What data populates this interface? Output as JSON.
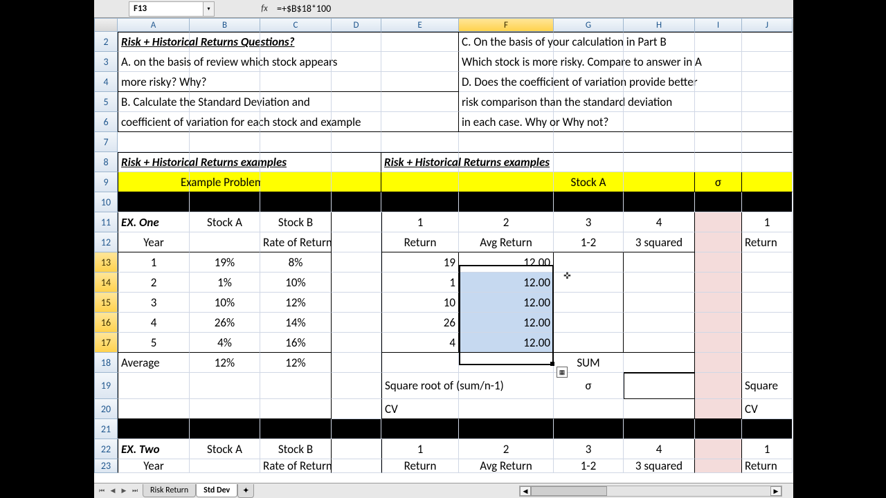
{
  "namebox": "F13",
  "formula": "=+$B$18*100",
  "fx_label": "fx",
  "columns": [
    "A",
    "B",
    "C",
    "D",
    "E",
    "F",
    "G",
    "H",
    "I",
    "J"
  ],
  "active_col": "F",
  "rows": {
    "2": {
      "A": "Risk + Historical Returns Questions?",
      "F": "C. On the basis of your calculation in Part B"
    },
    "3": {
      "A": "A. on the basis of review which stock appears",
      "F": "Which stock is more risky. Compare to answer in A"
    },
    "4": {
      "A": "more risky?  Why?",
      "F": "D. Does the coefficient of variation provide better"
    },
    "5": {
      "A": "B. Calculate the Standard Deviation and",
      "F": "risk comparison than the standard deviation"
    },
    "6": {
      "A": "coefficient of variation for each stock and example",
      "F": "in each case. Why or Why not?"
    },
    "8": {
      "A": "Risk + Historical Returns examples",
      "E": "Risk + Historical Returns examples"
    },
    "9": {
      "A": "Example Problems",
      "E": "Stock A",
      "I": "σ"
    },
    "11": {
      "A": "EX. One",
      "B": "Stock A",
      "C": "Stock B",
      "E": "1",
      "F": "2",
      "G": "3",
      "H": "4",
      "J": "1"
    },
    "12": {
      "A": "Year",
      "B": "Rate of Return",
      "E": "Return",
      "F": "Avg Return",
      "G": "1-2",
      "H": "3 squared",
      "J": "Return"
    },
    "13": {
      "A": "1",
      "B": "19%",
      "C": "8%",
      "E": "19",
      "F": "12.00"
    },
    "14": {
      "A": "2",
      "B": "1%",
      "C": "10%",
      "E": "1",
      "F": "12.00"
    },
    "15": {
      "A": "3",
      "B": "10%",
      "C": "12%",
      "E": "10",
      "F": "12.00"
    },
    "16": {
      "A": "4",
      "B": "26%",
      "C": "14%",
      "E": "26",
      "F": "12.00"
    },
    "17": {
      "A": "5",
      "B": "4%",
      "C": "16%",
      "E": "4",
      "F": "12.00"
    },
    "18": {
      "A": "Average",
      "B": "12%",
      "C": "12%",
      "G": "SUM"
    },
    "19": {
      "E": "Square root of (sum/n-1)",
      "G": "σ",
      "J": "Square"
    },
    "20": {
      "E": "CV",
      "J": "CV"
    },
    "22": {
      "A": "EX. Two",
      "B": "Stock A",
      "C": "Stock B",
      "E": "1",
      "F": "2",
      "G": "3",
      "H": "4",
      "J": "1"
    },
    "23": {
      "A": "Year",
      "B": "Rate of Return",
      "E": "Return",
      "F": "Avg Return",
      "G": "1-2",
      "H": "3 squared",
      "J": "Return"
    }
  },
  "active_rows": [
    "13",
    "14",
    "15",
    "16",
    "17"
  ],
  "sheets": {
    "nav": [
      "⏮",
      "◀",
      "▶",
      "⏭"
    ],
    "tabs": [
      "Risk Return",
      "Std Dev"
    ],
    "active": 1,
    "new": "✦"
  },
  "autofill_icon": "▦"
}
